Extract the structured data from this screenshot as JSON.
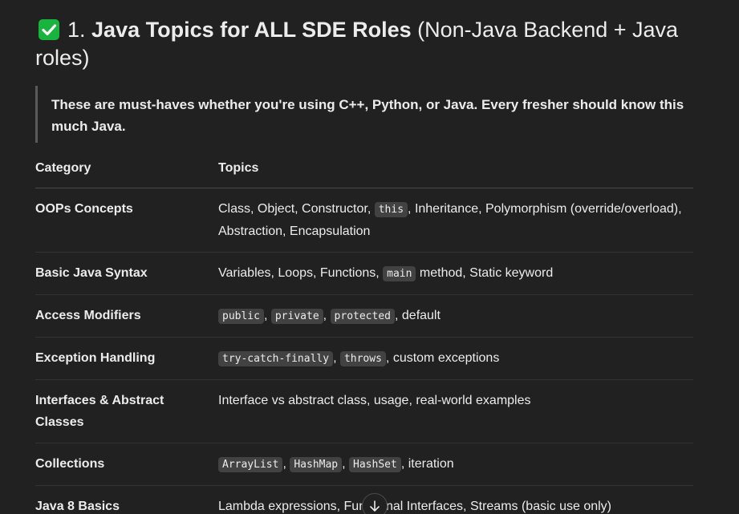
{
  "heading": {
    "prefix": "1. ",
    "bold": "Java Topics for ALL SDE Roles",
    "rest": " (Non-Java Backend + Java roles)"
  },
  "quote": "These are must-haves whether you're using C++, Python, or Java. Every fresher should know this much Java.",
  "table": {
    "headers": [
      "Category",
      "Topics"
    ],
    "rows": [
      {
        "category": "OOPs Concepts",
        "topics": [
          {
            "t": "Class, Object, Constructor, "
          },
          {
            "c": "this"
          },
          {
            "t": ", Inheritance, Polymorphism (override/overload), Abstraction, Encapsulation"
          }
        ]
      },
      {
        "category": "Basic Java Syntax",
        "topics": [
          {
            "t": "Variables, Loops, Functions, "
          },
          {
            "c": "main"
          },
          {
            "t": " method, Static keyword"
          }
        ]
      },
      {
        "category": "Access Modifiers",
        "topics": [
          {
            "c": "public"
          },
          {
            "t": ", "
          },
          {
            "c": "private"
          },
          {
            "t": ", "
          },
          {
            "c": "protected"
          },
          {
            "t": ", default"
          }
        ]
      },
      {
        "category": "Exception Handling",
        "topics": [
          {
            "c": "try-catch-finally"
          },
          {
            "t": ", "
          },
          {
            "c": "throws"
          },
          {
            "t": ", custom exceptions"
          }
        ]
      },
      {
        "category": "Interfaces & Abstract Classes",
        "topics": [
          {
            "t": "Interface vs abstract class, usage, real-world examples"
          }
        ]
      },
      {
        "category": "Collections",
        "topics": [
          {
            "c": "ArrayList"
          },
          {
            "t": ", "
          },
          {
            "c": "HashMap"
          },
          {
            "t": ", "
          },
          {
            "c": "HashSet"
          },
          {
            "t": ", iteration"
          }
        ]
      },
      {
        "category": "Java 8 Basics",
        "topics": [
          {
            "t": "Lambda expressions, Functional Interfaces, Streams (basic use only)"
          }
        ]
      }
    ]
  },
  "icons": {
    "heading_icon": "check-mark-icon",
    "scroll_icon": "arrow-down-icon"
  },
  "colors": {
    "check_green": "#19b43e",
    "background": "#212121"
  }
}
